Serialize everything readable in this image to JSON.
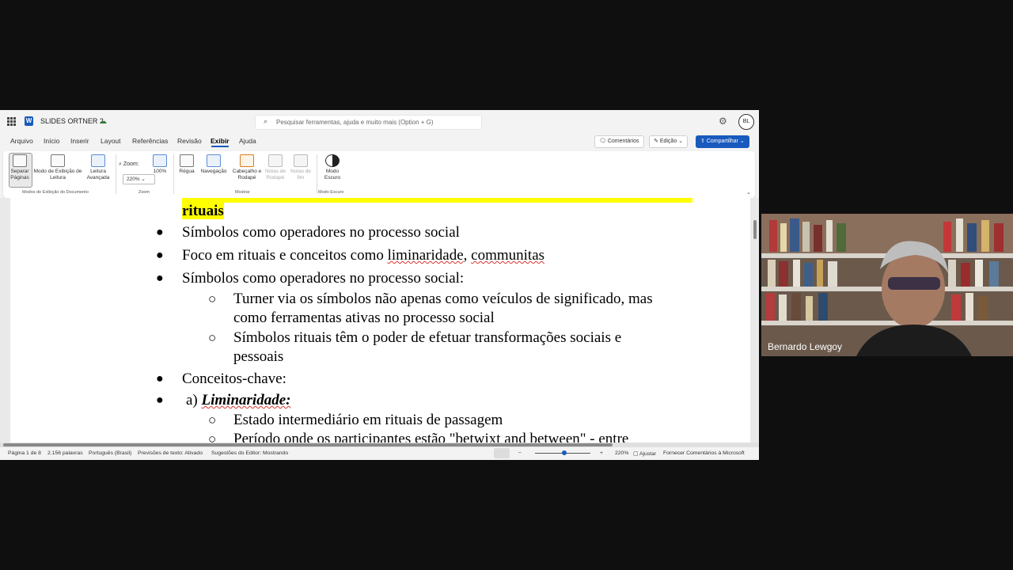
{
  "app": {
    "doc_title": "SLIDES ORTNER 2",
    "search_placeholder": "Pesquisar ferramentas, ajuda e muito mais (Option + G)",
    "user_initials": "BL"
  },
  "tabs": [
    "Arquivo",
    "Início",
    "Inserir",
    "Layout",
    "Referências",
    "Revisão",
    "Exibir",
    "Ajuda"
  ],
  "active_tab": "Exibir",
  "header_buttons": {
    "comments": "Comentários",
    "editing": "Edição",
    "share": "Compartilhar"
  },
  "ribbon": {
    "separate_pages": "Separar Páginas",
    "reading_mode": "Modo de Exibição de Leitura",
    "advanced_reading": "Leitura Avançada",
    "group_doc_views": "Modos de Exibição do Documento",
    "zoom_label": "Zoom:",
    "zoom_value": "220%",
    "hundred": "100%",
    "group_zoom": "Zoom",
    "ruler": "Régua",
    "navigation": "Navegação",
    "header_footer": "Cabeçalho e Rodapé",
    "footnotes": "Notas de Rodapé",
    "endnotes": "Notas de fim",
    "group_show": "Mostrar",
    "dark_mode": "Modo Escuro",
    "group_dark": "Modo Escuro"
  },
  "document": {
    "line_rituais": "rituais",
    "b1": "Símbolos como operadores no processo social",
    "b2_pre": "Foco em rituais e conceitos como ",
    "b2_w1": "liminaridade",
    "b2_mid": ", ",
    "b2_w2": "communitas",
    "b3": "Símbolos como operadores no processo social:",
    "s1a": "Turner via os símbolos não apenas como veículos de significado, mas",
    "s1b": "como ferramentas ativas no processo social",
    "s2a": "Símbolos rituais têm o poder de efetuar transformações sociais e",
    "s2b": "pessoais",
    "b4": "Conceitos-chave:",
    "b5_pre": "a) ",
    "b5_em": "Liminaridade:",
    "s3": "Estado intermediário em rituais de passagem",
    "s4": "Período onde os participantes estão \"betwixt and between\" - entre"
  },
  "status": {
    "page": "Página 1 de 8",
    "words": "2.156 palavras",
    "lang": "Português (Brasil)",
    "predictions": "Previsões de texto: Ativado",
    "editor": "Sugestões do Editor: Mostrando",
    "zoom": "220%",
    "fit": "Ajustar",
    "feedback": "Fornecer Comentários à Microsoft"
  },
  "participant": {
    "name": "Bernardo Lewgoy"
  }
}
